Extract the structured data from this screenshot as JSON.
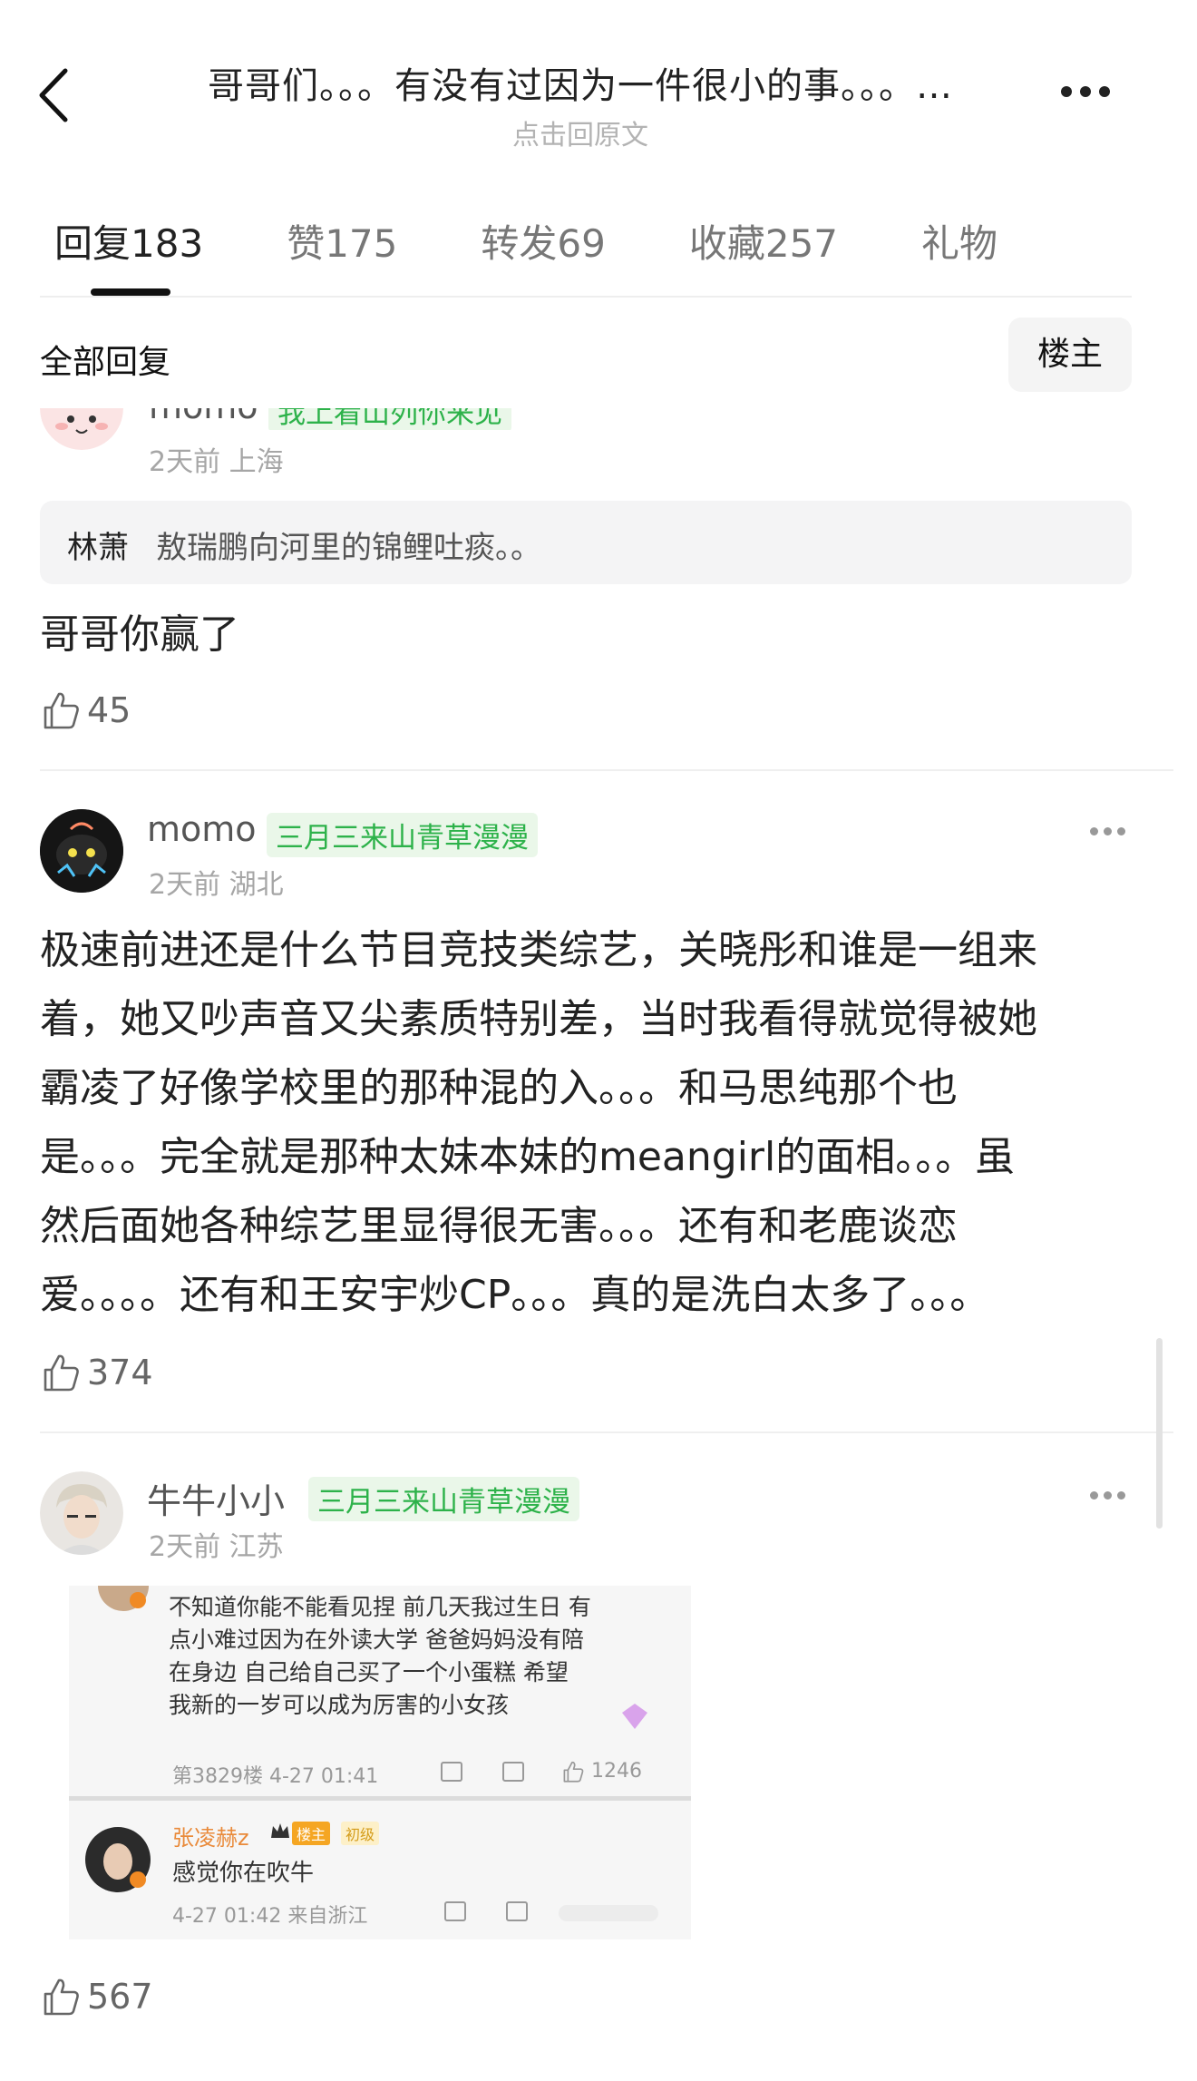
{
  "header": {
    "title": "哥哥们。。。有没有过因为一件很小的事。。。…",
    "subtitle": "点击回原文"
  },
  "tabs": [
    {
      "label": "回复",
      "count": "183"
    },
    {
      "label": "赞",
      "count": "175"
    },
    {
      "label": "转发",
      "count": "69"
    },
    {
      "label": "收藏",
      "count": "257"
    },
    {
      "label": "礼物",
      "count": ""
    }
  ],
  "filter": {
    "all_label": "全部回复",
    "owner_label": "楼主"
  },
  "comments": [
    {
      "username": "momo",
      "tag": "我上看山列你来见",
      "meta": "2天前 上海",
      "quote_name": "林萧",
      "quote_text": "敖瑞鹏向河里的锦鲤吐痰。。",
      "text": "哥哥你赢了",
      "likes": "45"
    },
    {
      "username": "momo",
      "tag": "三月三来山青草漫漫",
      "meta": "2天前 湖北",
      "lines": [
        "极速前进还是什么节目竞技类综艺，关晓彤和谁是一组来",
        "着，她又吵声音又尖素质特别差，当时我看得就觉得被她",
        "霸凌了好像学校里的那种混的入。。。和马思纯那个也",
        "是。。。完全就是那种太妹本妹的meangirl的面相。。。虽",
        "然后面她各种综艺里显得很无害。。。还有和老鹿谈恋",
        "爱。。。。还有和王安宇炒CP。。。真的是洗白太多了。。。"
      ],
      "likes": "374"
    },
    {
      "username": "牛牛小小",
      "tag": "三月三来山青草漫漫",
      "meta": "2天前 江苏",
      "likes": "567",
      "embed": {
        "lines": [
          "不知道你能不能看见捏 前几天我过生日 有",
          "点小难过因为在外读大学 爸爸妈妈没有陪",
          "在身边 自己给自己买了一个小蛋糕 希望",
          "我新的一岁可以成为厉害的小女孩"
        ],
        "floor_meta": "第3829楼 4-27 01:41",
        "floor_likes": "1246",
        "reply_name": "张凌赫z",
        "badge_owner": "楼主",
        "badge_level": "初级",
        "reply_text": "感觉你在吹牛",
        "reply_meta": "4-27 01:42 来自浙江"
      }
    }
  ]
}
